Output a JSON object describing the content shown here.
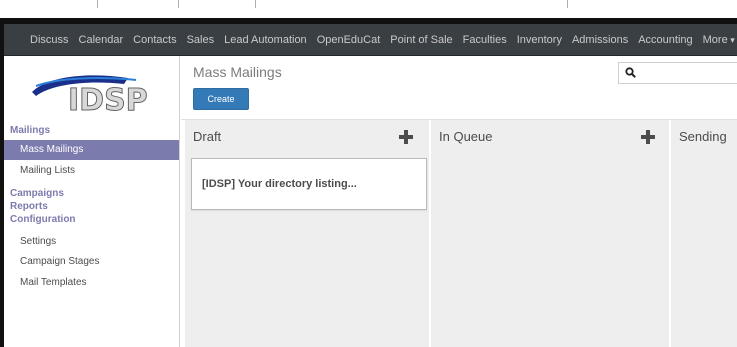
{
  "navbar": {
    "items": [
      "Discuss",
      "Calendar",
      "Contacts",
      "Sales",
      "Lead Automation",
      "OpenEduCat",
      "Point of Sale",
      "Faculties",
      "Inventory",
      "Admissions",
      "Accounting",
      "More"
    ]
  },
  "sidebar": {
    "logo_text": "IDSP",
    "sections": {
      "mailings": "Mailings",
      "campaigns": "Campaigns",
      "reports": "Reports",
      "configuration": "Configuration"
    },
    "items": {
      "mass_mailings": "Mass Mailings",
      "mailing_lists": "Mailing Lists",
      "settings": "Settings",
      "campaign_stages": "Campaign Stages",
      "mail_templates": "Mail Templates"
    }
  },
  "header": {
    "title": "Mass Mailings",
    "create_label": "Create",
    "search_placeholder": ""
  },
  "kanban": {
    "columns": [
      {
        "title": "Draft",
        "cards": [
          "[IDSP] Your directory listing..."
        ]
      },
      {
        "title": "In Queue",
        "cards": []
      },
      {
        "title": "Sending",
        "cards": []
      }
    ]
  },
  "colors": {
    "navbar": "#3a3f44",
    "accent": "#7c7bad",
    "button": "#337ab7",
    "column": "#eeeeee"
  },
  "icons": {
    "search": "magnifier-icon",
    "add": "plus-icon"
  }
}
